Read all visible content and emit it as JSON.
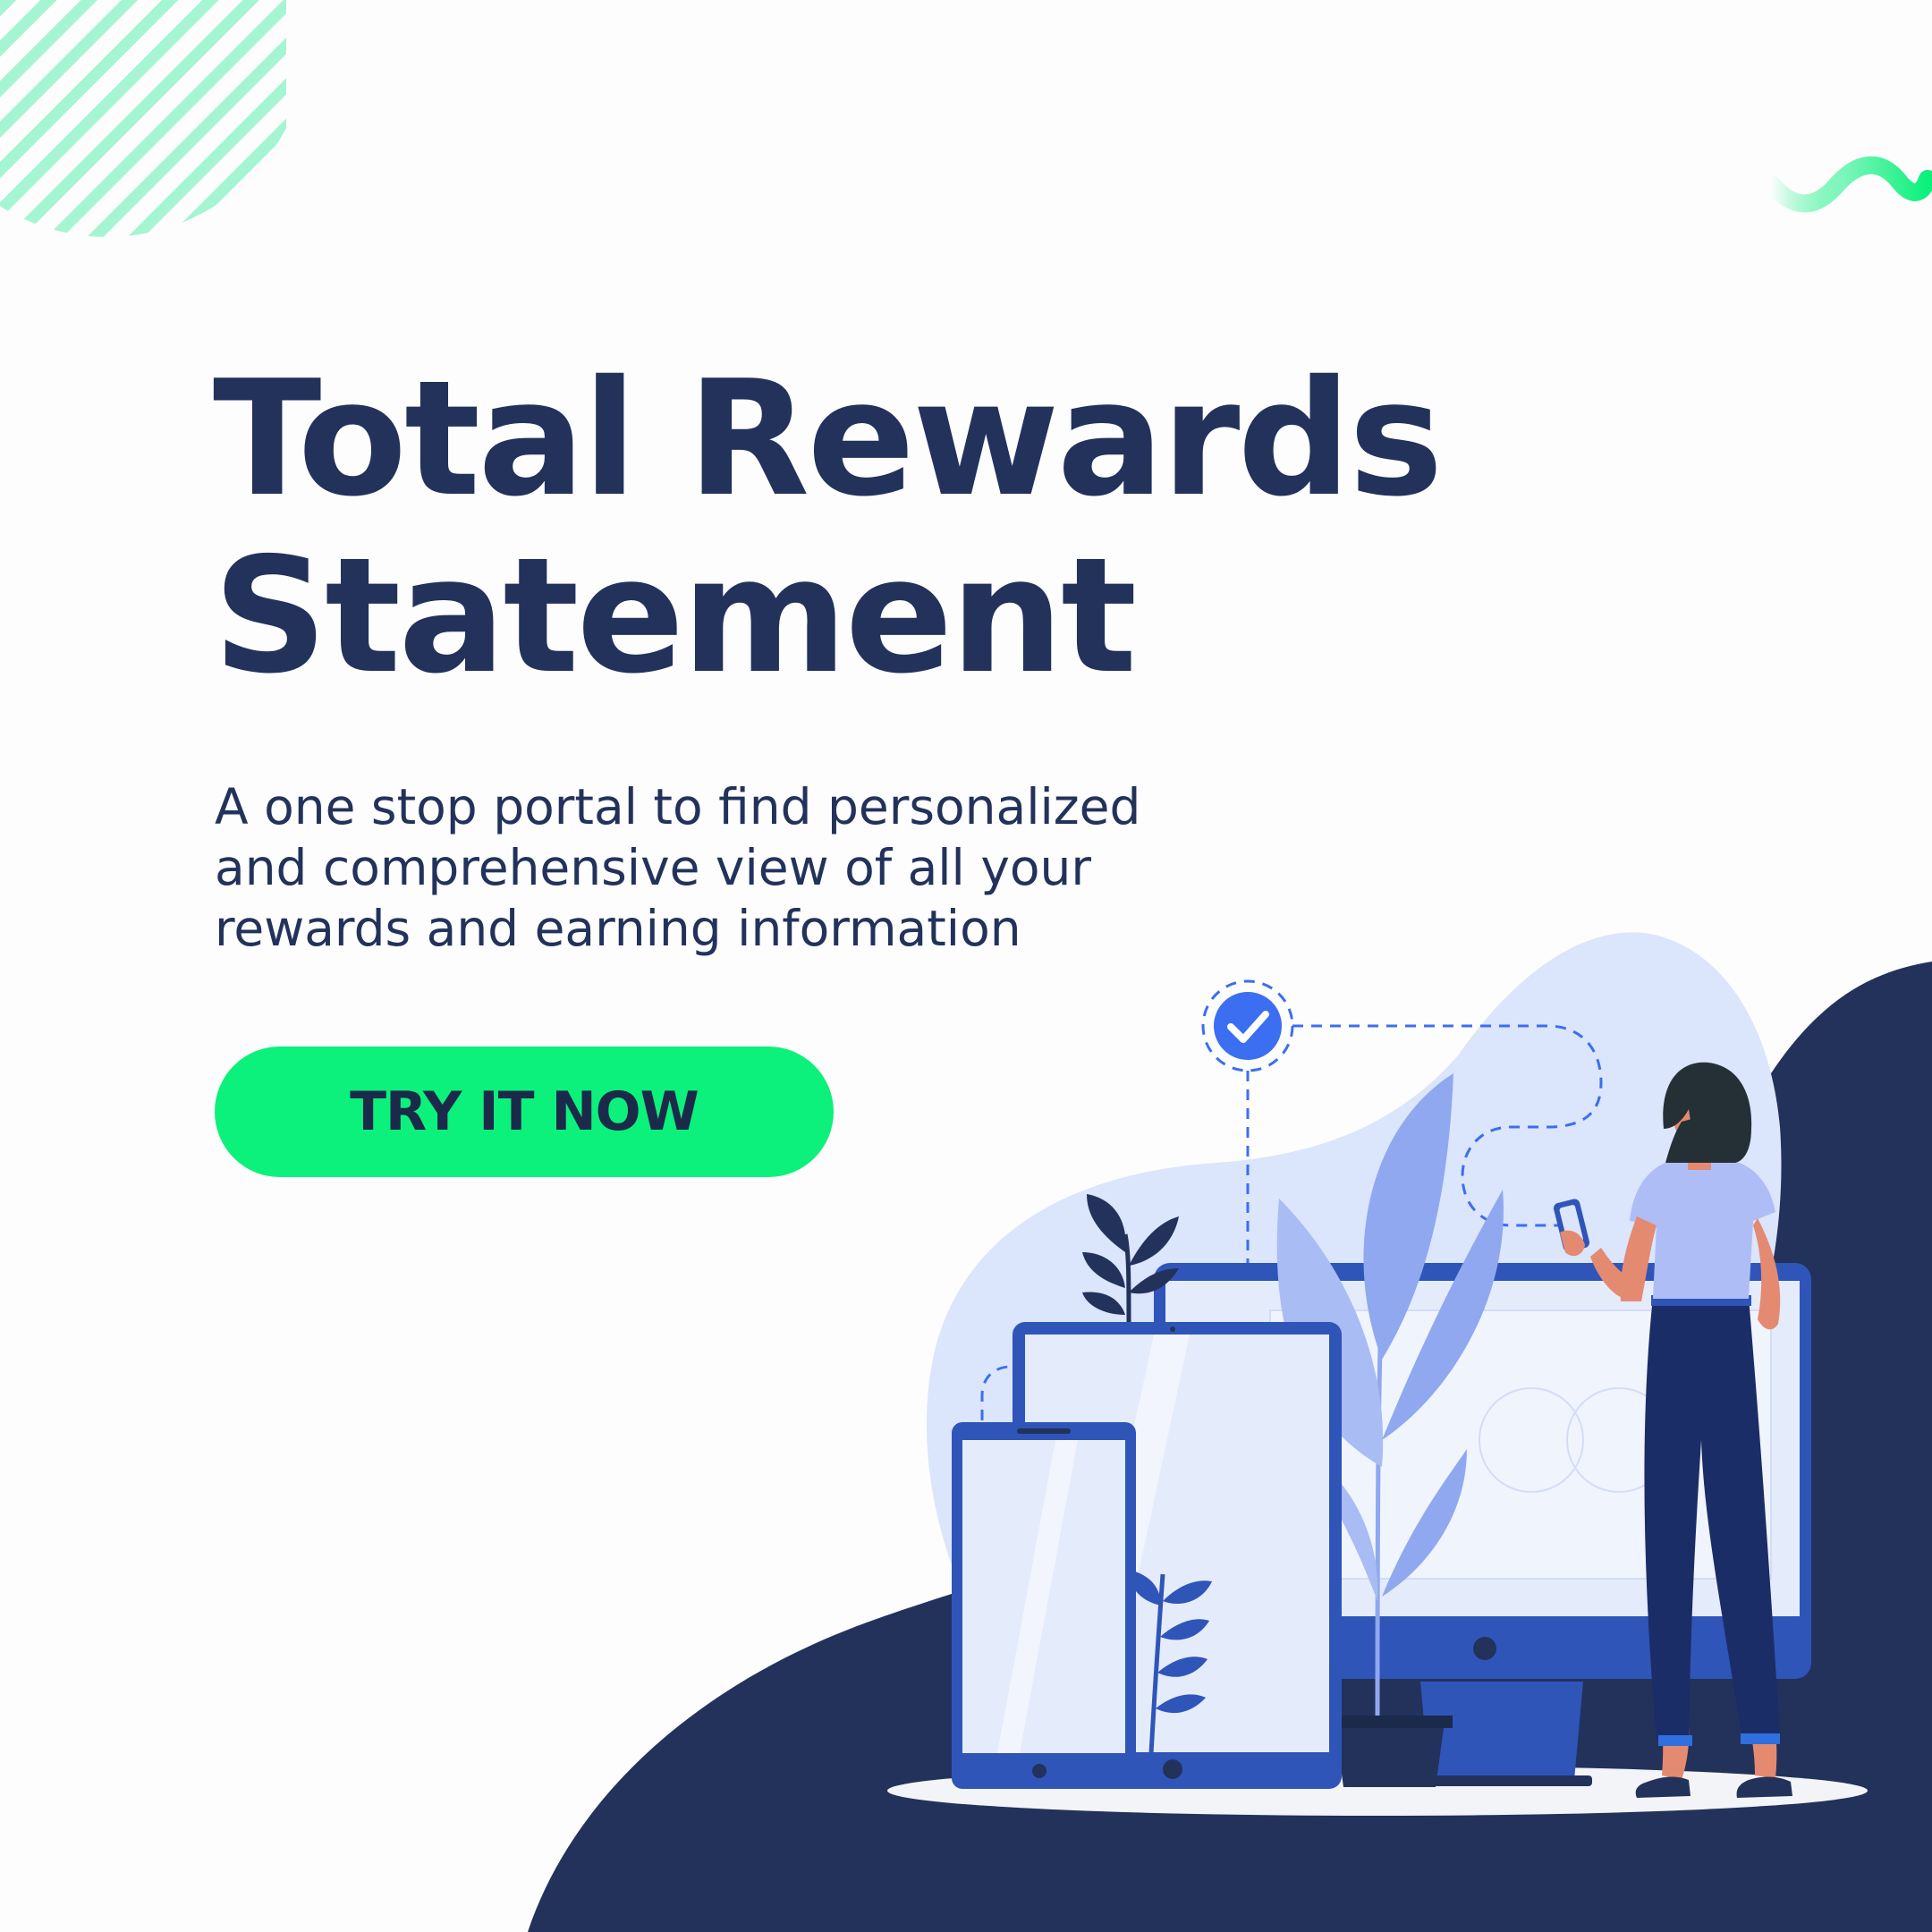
{
  "headline": {
    "line1": "Total Rewards",
    "line2": "Statement"
  },
  "description": {
    "line1": "A one stop portal to find personalized",
    "line2": "and comprehensive view of all your",
    "line3": "rewards and earning information"
  },
  "cta": {
    "label": "TRY IT NOW"
  },
  "colors": {
    "navy": "#22325b",
    "accent_green": "#0cf17b",
    "mint": "#a6f5d2",
    "royal_blue": "#2f55b8",
    "light_blue": "#dbe5fb",
    "periwinkle": "#8fa8ef",
    "check_blue": "#3b6ef0"
  },
  "icons": [
    "checkmark-icon",
    "squiggle-decoration",
    "striped-circle-decoration",
    "leaf-plant",
    "smartphone",
    "tablet",
    "monitor"
  ]
}
